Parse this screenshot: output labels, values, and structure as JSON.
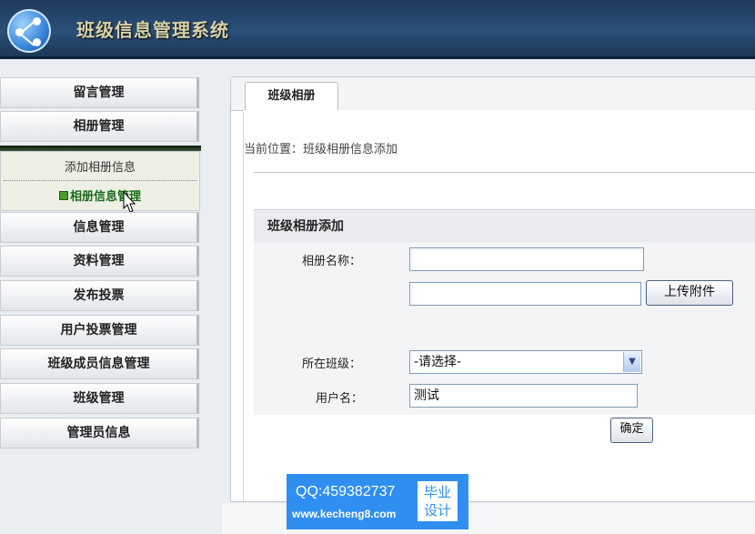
{
  "app": {
    "title": "班级信息管理系统"
  },
  "sidebar": {
    "items": [
      {
        "label": "留言管理"
      },
      {
        "label": "相册管理"
      },
      {
        "label": "信息管理"
      },
      {
        "label": "资料管理"
      },
      {
        "label": "发布投票"
      },
      {
        "label": "用户投票管理"
      },
      {
        "label": "班级成员信息管理"
      },
      {
        "label": "班级管理"
      },
      {
        "label": "管理员信息"
      }
    ],
    "submenu": {
      "add_label": "添加相册信息",
      "manage_label": "相册信息管理"
    }
  },
  "main": {
    "tab_label": "班级相册",
    "breadcrumb": "当前位置：班级相册信息添加",
    "form": {
      "header": "班级相册添加",
      "album_name_label": "相册名称：",
      "album_name_value": "",
      "file_value": "",
      "upload_label": "上传附件",
      "class_label": "所在班级：",
      "class_selected": "-请选择-",
      "username_label": "用户名：",
      "username_value": "测试",
      "confirm_label": "确定"
    }
  },
  "watermark": {
    "qq": "QQ:459382737",
    "url": "www.kecheng8.com",
    "badge_line1": "毕业",
    "badge_line2": "设计"
  }
}
